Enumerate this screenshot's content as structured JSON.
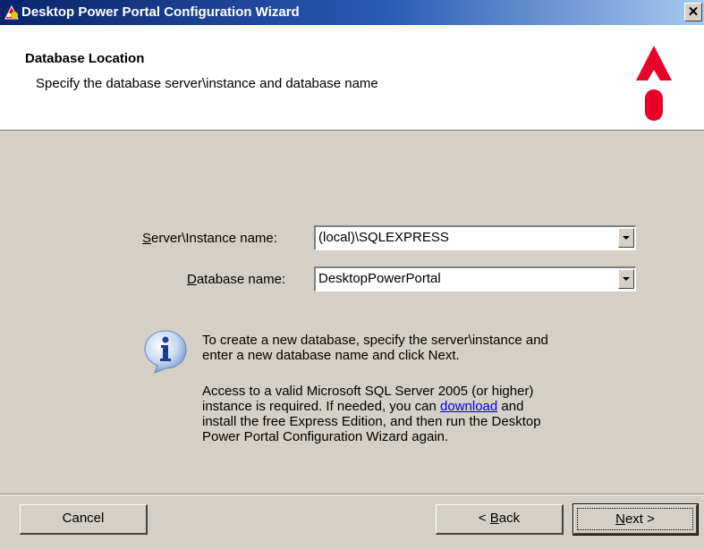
{
  "window": {
    "title": "Desktop Power Portal Configuration Wizard",
    "close_label": "✕"
  },
  "header": {
    "title": "Database Location",
    "subtitle": "Specify the database server\\instance and database name",
    "logo_icon": "desktop-power-portal-logo",
    "accent_color": "#e8002a"
  },
  "form": {
    "server": {
      "label_mnemonic": "S",
      "label_rest": "erver\\Instance name:",
      "value": "(local)\\SQLEXPRESS"
    },
    "database": {
      "label_mnemonic": "D",
      "label_rest": "atabase name:",
      "value": "DesktopPowerPortal"
    }
  },
  "info": {
    "icon": "info-icon",
    "line1": "To create a new database, specify the server\\instance and",
    "line2": "enter a new database name and click Next.",
    "para2_line1": "Access to a valid Microsoft SQL Server 2005 (or higher)",
    "para2_line2_pre": "instance is required.  If needed, you can ",
    "para2_link": "download",
    "para2_line2_post": " and",
    "para2_line3": "install the free Express Edition, and then run the Desktop",
    "para2_line4": "Power Portal Configuration Wizard again."
  },
  "buttons": {
    "cancel": "Cancel",
    "back_mnemonic": "B",
    "back_rest": "ack",
    "back_prefix": "< ",
    "next_mnemonic": "N",
    "next_rest": "ext >"
  }
}
